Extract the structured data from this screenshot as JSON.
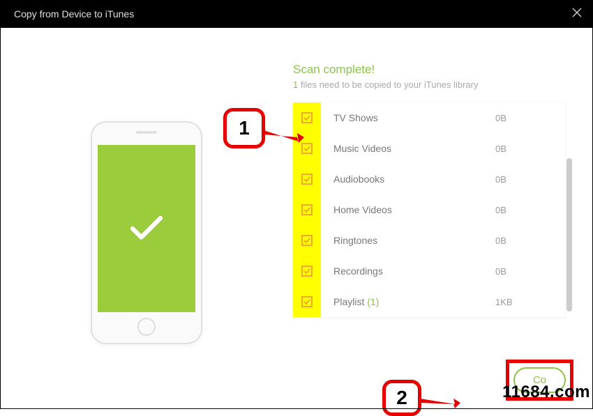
{
  "titlebar": {
    "title": "Copy from Device to iTunes"
  },
  "status": {
    "heading": "Scan complete!",
    "count": "1",
    "sub_suffix": " files need to be copied to your iTunes library"
  },
  "rows": [
    {
      "label": "TV Shows",
      "count": "",
      "size": "0B"
    },
    {
      "label": "Music Videos",
      "count": "",
      "size": "0B"
    },
    {
      "label": "Audiobooks",
      "count": "",
      "size": "0B"
    },
    {
      "label": "Home Videos",
      "count": "",
      "size": "0B"
    },
    {
      "label": "Ringtones",
      "count": "",
      "size": "0B"
    },
    {
      "label": "Recordings",
      "count": "",
      "size": "0B"
    },
    {
      "label": "Playlist ",
      "count": "(1)",
      "size": "1KB"
    }
  ],
  "callouts": {
    "one": "1",
    "two": "2"
  },
  "primary_button": {
    "label": "Co"
  },
  "watermark": {
    "text": "11684.com"
  },
  "icons": {
    "close": "close-icon",
    "check": "check-icon",
    "phone_check": "phone-check-icon"
  }
}
